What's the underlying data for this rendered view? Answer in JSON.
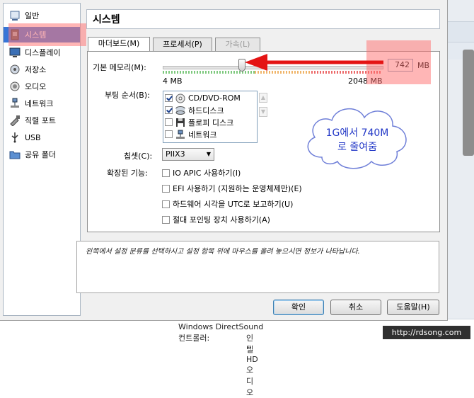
{
  "sidebar": {
    "items": [
      {
        "label": "일반",
        "icon": "general-icon"
      },
      {
        "label": "시스템",
        "icon": "system-icon"
      },
      {
        "label": "디스플레이",
        "icon": "display-icon"
      },
      {
        "label": "저장소",
        "icon": "storage-icon"
      },
      {
        "label": "오디오",
        "icon": "audio-icon"
      },
      {
        "label": "네트워크",
        "icon": "network-icon"
      },
      {
        "label": "직렬 포트",
        "icon": "serial-port-icon"
      },
      {
        "label": "USB",
        "icon": "usb-icon"
      },
      {
        "label": "공유 폴더",
        "icon": "shared-folder-icon"
      }
    ],
    "selected": 1
  },
  "header": {
    "title": "시스템"
  },
  "tabs": [
    {
      "label": "마더보드(M)",
      "active": true
    },
    {
      "label": "프로세서(P)",
      "active": false
    },
    {
      "label": "가속(L)",
      "disabled": true
    }
  ],
  "motherboard": {
    "memory_label": "기본 메모리(M):",
    "memory_min": "4 MB",
    "memory_max": "2048 MB",
    "memory_value": "742",
    "memory_unit": "MB",
    "memory_fraction": 0.36,
    "boot_label": "부팅 순서(B):",
    "boot_items": [
      {
        "label": "CD/DVD-ROM",
        "checked": true
      },
      {
        "label": "하드디스크",
        "checked": true
      },
      {
        "label": "플로피 디스크",
        "checked": false
      },
      {
        "label": "네트워크",
        "checked": false
      }
    ],
    "chipset_label": "칩셋(C):",
    "chipset_value": "PIIX3",
    "ext_label": "확장된 기능:",
    "ext_options": [
      {
        "label": "IO APIC 사용하기(I)",
        "checked": false
      },
      {
        "label": "EFI 사용하기 (지원하는 운영체제만)(E)",
        "checked": false
      },
      {
        "label": "하드웨어 시각을 UTC로 보고하기(U)",
        "checked": false
      },
      {
        "label": "절대 포인팅 장치 사용하기(A)",
        "checked": false
      }
    ]
  },
  "annotation": {
    "line1": "1G에서 740M",
    "line2": "로 줄여줌"
  },
  "info_text": "왼쪽에서 설정 분류를 선택하시고 설정 항목 위에 마우스를 올려 놓으시면 정보가 나타납니다.",
  "buttons": {
    "ok": "확인",
    "cancel": "취소",
    "help": "도움말(H)"
  },
  "background": {
    "row1": "Windows DirectSound",
    "row2_label": "컨트롤러:",
    "row2_value": "인텔 HD 오디오",
    "watermark": "http://rdsong.com"
  },
  "colors": {
    "selection": "#3875d7",
    "annotation_text": "#2338c7",
    "highlight": "#ff6e6e"
  }
}
